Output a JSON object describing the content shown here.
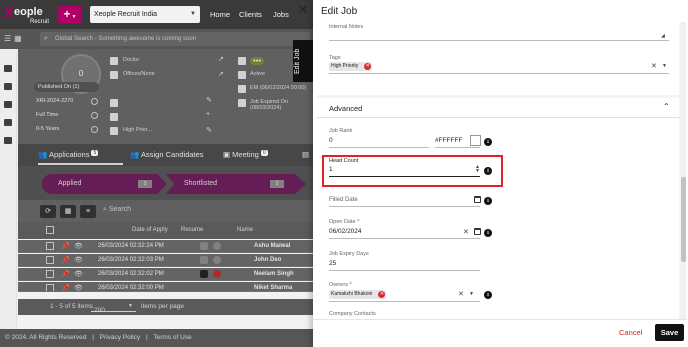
{
  "brand": {
    "logo_x": "X",
    "logo_text": "eople",
    "logo_sub": "Recruit"
  },
  "topbar": {
    "add_label": "+",
    "company_selected": "Xeople Recruit India",
    "nav": [
      "Home",
      "Clients",
      "Jobs"
    ]
  },
  "global_search": {
    "placeholder": "Global Search - Something awesome is coming soon"
  },
  "job_summary": {
    "avatar_count": "0",
    "published": "Published On (1)",
    "ref": "XRI-2024-2270",
    "type": "Full Time",
    "experience": "0-5 Years",
    "fields": [
      "Doctor",
      "Offices/None",
      "High Prior..."
    ],
    "status_chip": "Active",
    "date_line": "EM (06/02/2024 00:00)",
    "expired_line": "Job Expired On (08/03/2024)"
  },
  "tabs": [
    {
      "label": "Applications",
      "count": "5"
    },
    {
      "label": "Assign Candidates",
      "count": ""
    },
    {
      "label": "Meeting",
      "count": "0"
    }
  ],
  "pipeline": [
    {
      "label": "Applied",
      "count": "3"
    },
    {
      "label": "Shortlisted",
      "count": "2"
    }
  ],
  "list_toolbar": {
    "search_label": "Search"
  },
  "grid": {
    "headers": [
      "Date of Apply",
      "Resume",
      "Name"
    ],
    "rows": [
      {
        "date": "26/03/2024 02:32:24 PM",
        "name": "Ashu Maiwal"
      },
      {
        "date": "26/03/2024 02:32:03 PM",
        "name": "John Deo"
      },
      {
        "date": "26/03/2024 02:32:02 PM",
        "name": "Neelam Singh"
      },
      {
        "date": "26/03/2024 02:32:00 PM",
        "name": "Niket Sharma"
      }
    ]
  },
  "pager": {
    "range": "1 - 5 of 5 items",
    "page_size": "200",
    "suffix": "items per page"
  },
  "footer": {
    "copyright": "© 2024. All Rights Reserved",
    "privacy": "Privacy Policy",
    "terms": "Terms of Use"
  },
  "side_tab": "Edit Job",
  "drawer": {
    "title": "Edit Job",
    "internal_notes_label": "Internal Notes",
    "tags_label": "Tags",
    "tags": [
      "High Priority"
    ],
    "advanced_label": "Advanced",
    "job_rank_label": "Job Rank",
    "job_rank_value": "0",
    "color_value": "#FFFFFF",
    "head_count_label": "Head Count",
    "head_count_value": "1",
    "filled_date_label": "Filled Date",
    "open_date_label": "Open Date *",
    "open_date_value": "06/02/2024",
    "expiry_label": "Job Expiry Days",
    "expiry_value": "25",
    "owners_label": "Owners *",
    "owners": [
      "Kamakshi Bhakoni"
    ],
    "company_contacts_label": "Company Contacts",
    "cancel_label": "Cancel",
    "save_label": "Save"
  },
  "colors": {
    "brand": "#b8006b",
    "topbar": "#3e3e3e",
    "danger": "#e2202a",
    "primary_button": "#111111"
  }
}
